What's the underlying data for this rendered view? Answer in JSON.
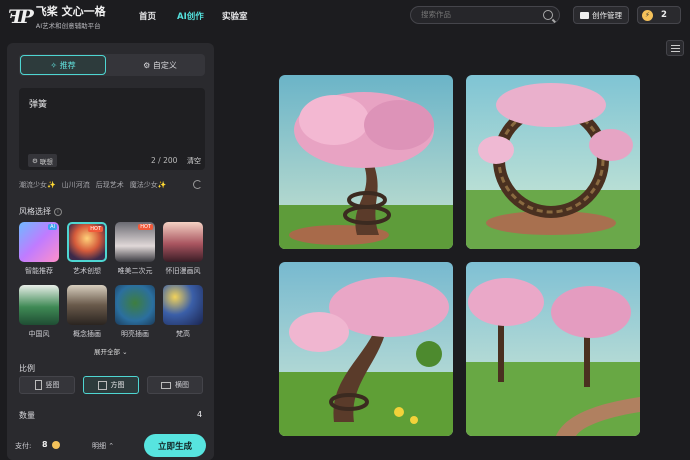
{
  "header": {
    "logo_mark": "ꟻP",
    "brand": "飞桨 文心一格",
    "tagline": "AI艺术和创意辅助平台",
    "nav": [
      "首页",
      "AI创作",
      "实验室"
    ],
    "active_nav": "AI创作",
    "search_placeholder": "搜索作品",
    "manage_label": "创作管理",
    "credits": "2"
  },
  "panel": {
    "tabs": [
      "推荐",
      "自定义"
    ],
    "active_tab": "推荐",
    "prompt": "弹簧",
    "associate_label": "联想",
    "count": "2 / 200",
    "clear_label": "清空",
    "tags": [
      "潮流少女✨",
      "山川河流",
      "后现艺术",
      "魔法少女✨"
    ],
    "style_title": "风格选择",
    "styles": [
      {
        "label": "智能推荐",
        "badge": "AI"
      },
      {
        "label": "艺术创想",
        "badge": "HOT",
        "selected": true
      },
      {
        "label": "唯美二次元",
        "badge": "HOT"
      },
      {
        "label": "怀旧漫画风",
        "badge": ""
      },
      {
        "label": "中国风",
        "badge": ""
      },
      {
        "label": "概念插画",
        "badge": ""
      },
      {
        "label": "明亮插画",
        "badge": ""
      },
      {
        "label": "梵高",
        "badge": ""
      }
    ],
    "expand_label": "展开全部",
    "ratio_title": "比例",
    "ratios": [
      "竖图",
      "方图",
      "横图"
    ],
    "active_ratio": "方图",
    "quantity_title": "数量",
    "quantity": "4",
    "pay_label": "支付:",
    "pay_value": "8",
    "detail_label": "明细",
    "generate_label": "立即生成"
  },
  "colors": {
    "accent": "#4ed6d2",
    "generate": "#57e4df",
    "panel": "#2a2a2e",
    "bg": "#1c1c1f"
  }
}
